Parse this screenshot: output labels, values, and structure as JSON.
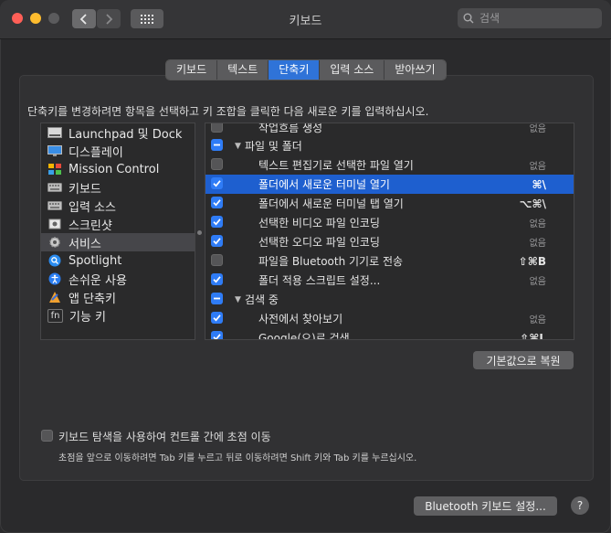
{
  "window": {
    "title": "키보드"
  },
  "search": {
    "placeholder": "검색"
  },
  "tabs": [
    {
      "label": "키보드"
    },
    {
      "label": "텍스트"
    },
    {
      "label": "단축키",
      "active": true
    },
    {
      "label": "입력 소스"
    },
    {
      "label": "받아쓰기"
    }
  ],
  "description": "단축키를 변경하려면 항목을 선택하고 키 조합을 클릭한 다음 새로운 키를 입력하십시오.",
  "categories": [
    {
      "label": "Launchpad 및 Dock",
      "icon": "launchpad-dock-icon"
    },
    {
      "label": "디스플레이",
      "icon": "display-icon"
    },
    {
      "label": "Mission Control",
      "icon": "mission-control-icon"
    },
    {
      "label": "키보드",
      "icon": "keyboard-icon"
    },
    {
      "label": "입력 소스",
      "icon": "input-source-icon"
    },
    {
      "label": "스크린샷",
      "icon": "screenshot-icon"
    },
    {
      "label": "서비스",
      "icon": "gear-icon",
      "selected": true
    },
    {
      "label": "Spotlight",
      "icon": "spotlight-icon"
    },
    {
      "label": "손쉬운 사용",
      "icon": "accessibility-icon"
    },
    {
      "label": "앱 단축키",
      "icon": "app-shortcuts-icon"
    },
    {
      "label": "기능 키",
      "icon": "fn-key-icon"
    }
  ],
  "shortcuts": [
    {
      "type": "item",
      "label": "작업흐름 생성",
      "checked": false,
      "key": "없음"
    },
    {
      "type": "group",
      "label": "파일 및 폴더",
      "checked": "mixed"
    },
    {
      "type": "item",
      "label": "텍스트 편집기로 선택한 파일 열기",
      "checked": false,
      "key": "없음"
    },
    {
      "type": "item",
      "label": "폴더에서 새로운 터미널 열기",
      "checked": true,
      "key": "⌘\\",
      "selected": true
    },
    {
      "type": "item",
      "label": "폴더에서 새로운 터미널 탭 열기",
      "checked": true,
      "key": "⌥⌘\\"
    },
    {
      "type": "item",
      "label": "선택한 비디오 파일 인코딩",
      "checked": true,
      "key": "없음"
    },
    {
      "type": "item",
      "label": "선택한 오디오 파일 인코딩",
      "checked": true,
      "key": "없음"
    },
    {
      "type": "item",
      "label": "파일을 Bluetooth 기기로 전송",
      "checked": false,
      "key": "⇧⌘B"
    },
    {
      "type": "item",
      "label": "폴더 적용 스크립트 설정...",
      "checked": true,
      "key": "없음"
    },
    {
      "type": "group",
      "label": "검색 중",
      "checked": "mixed"
    },
    {
      "type": "item",
      "label": "사전에서 찾아보기",
      "checked": true,
      "key": "없음"
    },
    {
      "type": "item",
      "label": "Google(으)로 검색",
      "checked": true,
      "key": "⇧⌘L"
    }
  ],
  "restore_button": "기본값으로 복원",
  "keyboard_nav": {
    "label": "키보드 탐색을 사용하여 컨트롤 간에 초점 이동",
    "help": "초점을 앞으로 이동하려면 Tab 키를 누르고 뒤로 이동하려면 Shift 키와 Tab 키를 누르십시오."
  },
  "bluetooth_button": "Bluetooth 키보드 설정...",
  "help_button": "?"
}
